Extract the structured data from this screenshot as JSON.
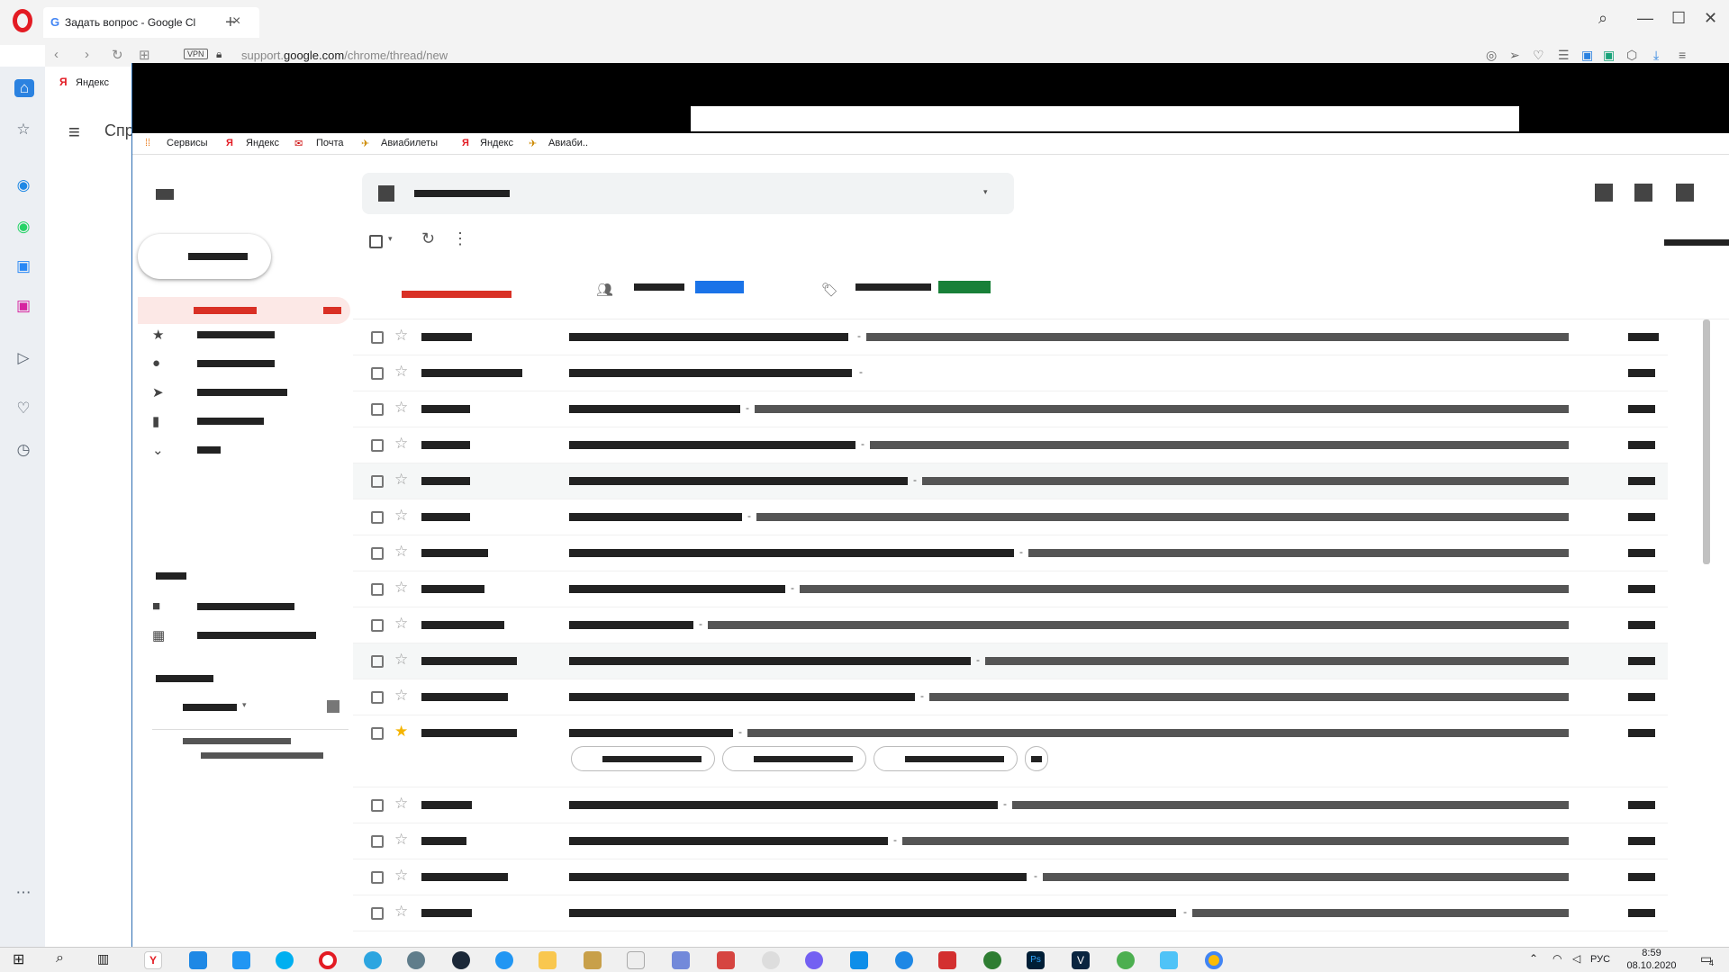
{
  "tab": {
    "title": "Задать вопрос - Google Cl",
    "favicon": "G"
  },
  "address": {
    "url_prefix": "support.",
    "url_domain": "google.com",
    "url_path": "/chrome/thread/new",
    "vpn": "VPN"
  },
  "opera_bookmarks": {
    "yandex": "Яндекс"
  },
  "bg_page": {
    "label": "Спр"
  },
  "chrome_bookmarks": [
    {
      "label": "Сервисы",
      "icon": "apps-grid-icon"
    },
    {
      "label": "Яндекс",
      "icon": "yandex-icon"
    },
    {
      "label": "Почта",
      "icon": "mail-envelope-icon"
    },
    {
      "label": "Авиабилеты",
      "icon": "plane-icon"
    },
    {
      "label": "Яндекс",
      "icon": "yandex-icon"
    },
    {
      "label": "Авиаби..",
      "icon": "plane-icon"
    }
  ],
  "taskbar": {
    "time": "8:59",
    "date": "08.10.2020",
    "lang": "РУС",
    "notifications": "4"
  },
  "colors": {
    "inbox_red": "#d93025",
    "people_blue": "#1a73e8",
    "promo_green": "#188038",
    "star_yellow": "#f4b400",
    "opera_red": "#e31b23"
  }
}
